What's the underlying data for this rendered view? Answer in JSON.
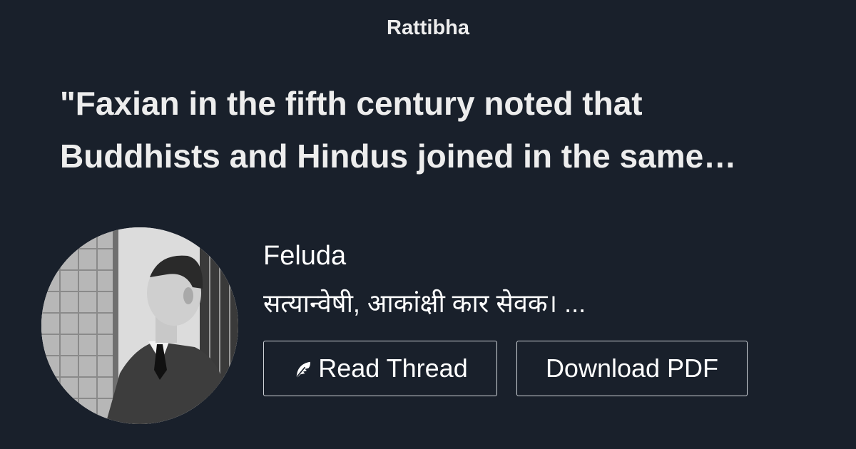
{
  "site": {
    "name": "Rattibha"
  },
  "thread": {
    "title": "\"Faxian in the fifth century noted that Buddhists and Hindus joined in the same…"
  },
  "author": {
    "name": "Feluda",
    "bio": "सत्यान्वेषी, आकांक्षी कार सेवक। ...",
    "avatar_icon": "avatar-photo"
  },
  "actions": {
    "read_label": "Read Thread",
    "read_icon": "feather-icon",
    "pdf_label": "Download PDF"
  },
  "colors": {
    "background": "#19202b",
    "text": "#ededed",
    "button_border": "#cfd3d8"
  }
}
